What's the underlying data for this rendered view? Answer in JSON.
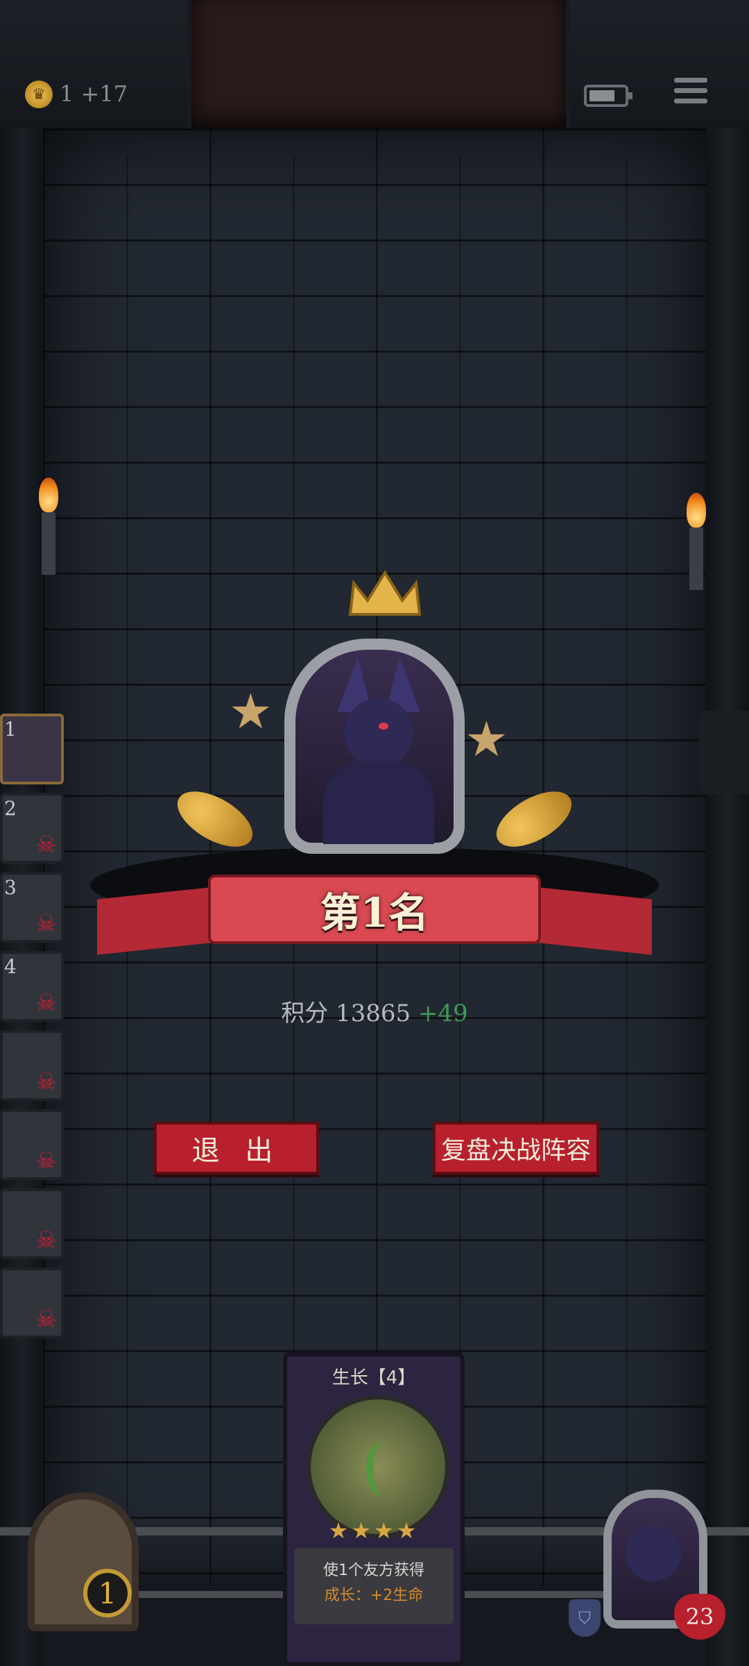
{
  "header": {
    "coin_icon": "crown-coin-icon",
    "coins_text": "1 +17",
    "battery_icon": "battery-icon",
    "menu_icon": "menu-icon"
  },
  "ranking": {
    "title": "第1名",
    "score_label": "积分",
    "score_value": "13865",
    "score_delta": "+49",
    "delta_color": "#3e9b55"
  },
  "buttons": {
    "exit": "退 出",
    "replay": "复盘决战阵容"
  },
  "players": [
    {
      "rank": "1",
      "eliminated": false
    },
    {
      "rank": "2",
      "eliminated": true
    },
    {
      "rank": "3",
      "eliminated": true
    },
    {
      "rank": "4",
      "eliminated": true
    },
    {
      "rank": "",
      "eliminated": true
    },
    {
      "rank": "",
      "eliminated": true
    },
    {
      "rank": "",
      "eliminated": true
    },
    {
      "rank": "",
      "eliminated": true
    }
  ],
  "card": {
    "title": "生长【4】",
    "stars": "★★★★",
    "desc_line1": "使1个友方获得",
    "desc_line2": "成长：+2生命"
  },
  "bottom": {
    "level": "1",
    "hero_health": "23"
  }
}
